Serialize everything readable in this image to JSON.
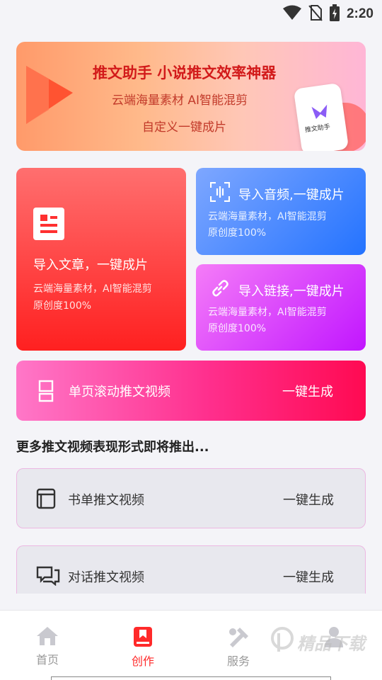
{
  "status_bar": {
    "time": "2:20"
  },
  "banner": {
    "headline": "推文助手 小说推文效率神器",
    "line2": "云端海量素材 AI智能混剪",
    "line3": "自定义一键成片",
    "phone_app_name": "推文助手"
  },
  "cards": {
    "article": {
      "title": "导入文章，一键成片",
      "sub1": "云端海量素材，AI智能混剪",
      "sub2": "原创度100%",
      "icon": "document-icon"
    },
    "audio": {
      "title": "导入音频,一键成片",
      "sub1": "云端海量素材，AI智能混剪",
      "sub2": "原创度100%",
      "icon": "audio-scan-icon"
    },
    "link": {
      "title": "导入链接,一键成片",
      "sub1": "云端海量素材，AI智能混剪",
      "sub2": "原创度100%",
      "icon": "link-icon"
    }
  },
  "scroll_video": {
    "label": "单页滚动推文视频",
    "action": "一键生成"
  },
  "more_section": {
    "title": "更多推文视频表现形式即将推出..."
  },
  "list": [
    {
      "label": "书单推文视频",
      "action": "一键生成",
      "icon": "book-icon"
    },
    {
      "label": "对话推文视频",
      "action": "一键生成",
      "icon": "chat-icon"
    }
  ],
  "tabs": [
    {
      "label": "首页",
      "icon": "home-icon",
      "active": false
    },
    {
      "label": "创作",
      "icon": "bookmark-icon",
      "active": true
    },
    {
      "label": "服务",
      "icon": "tools-icon",
      "active": false
    },
    {
      "label": "",
      "icon": "person-icon",
      "active": false
    }
  ],
  "watermark": {
    "text": "精品下载"
  },
  "colors": {
    "accent": "#ff2a2a",
    "audio_blue": "#2473ff",
    "link_purple": "#c116ff",
    "scroll_pink": "#ff2f8d"
  }
}
